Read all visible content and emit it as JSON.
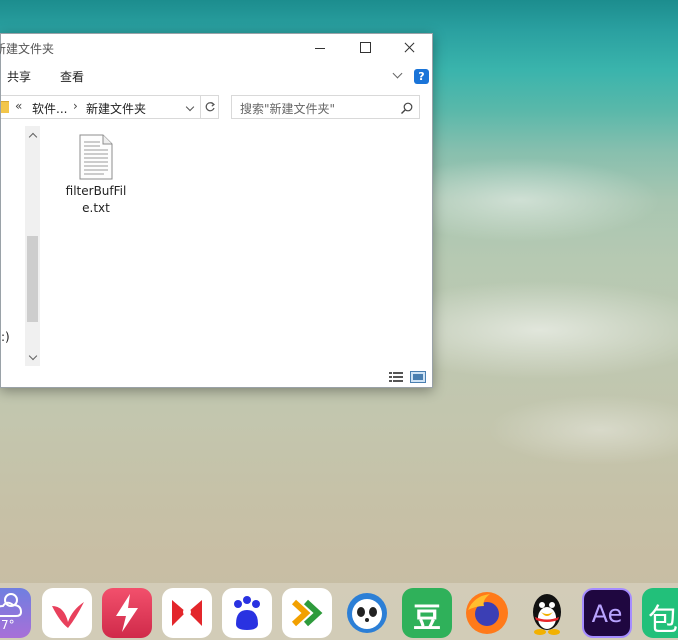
{
  "window": {
    "title": "新建文件夹",
    "ribbon_tabs": [
      "共享",
      "查看"
    ],
    "help_glyph": "?",
    "address": {
      "chevrons": "«",
      "crumbs": [
        "软件...",
        "新建文件夹"
      ],
      "separator": "›"
    },
    "search_placeholder": "搜索\"新建文件夹\"",
    "nav_drive_label": ":)",
    "file": {
      "name": "filterBufFile.txt",
      "icon": "text-file-icon"
    }
  },
  "dock": {
    "weather_temp": "7°",
    "apps": [
      "weather-icon",
      "bird-app-icon",
      "flash-app-icon",
      "xmind-icon",
      "baidu-netdisk-icon",
      "arrow-app-icon",
      "panda-app-icon",
      "douban-icon",
      "firefox-icon",
      "qq-icon",
      "after-effects-icon",
      "bao-app-icon"
    ],
    "douban_label": "豆",
    "ae_label": "Ae",
    "bao_label": "包"
  },
  "colors": {
    "accent_blue": "#1a74d8",
    "folder_yellow": "#f3c64a",
    "douban_green": "#2fb15a",
    "ae_purple": "#1f0740"
  }
}
